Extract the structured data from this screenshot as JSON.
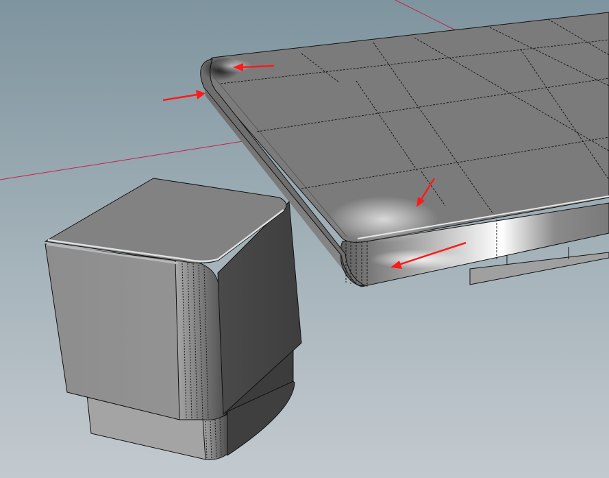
{
  "viewport": {
    "background_top": "#7d939d",
    "background_bottom": "#c2c9ce",
    "axis_color": "#c4204c",
    "annotation_color": "#ff1a1a",
    "wire_color": "#1a1a1a"
  },
  "objects": [
    {
      "name": "tabletop-slab",
      "icon": "rounded-box-mesh"
    },
    {
      "name": "table-leg",
      "icon": "rounded-box-mesh"
    }
  ],
  "annotations": [
    {
      "name": "arrow-top-left-corner",
      "icon": "arrow-left"
    },
    {
      "name": "arrow-left-edge",
      "icon": "arrow-right"
    },
    {
      "name": "arrow-front-face",
      "icon": "arrow-down-left"
    },
    {
      "name": "arrow-front-corner",
      "icon": "arrow-down-left"
    }
  ]
}
